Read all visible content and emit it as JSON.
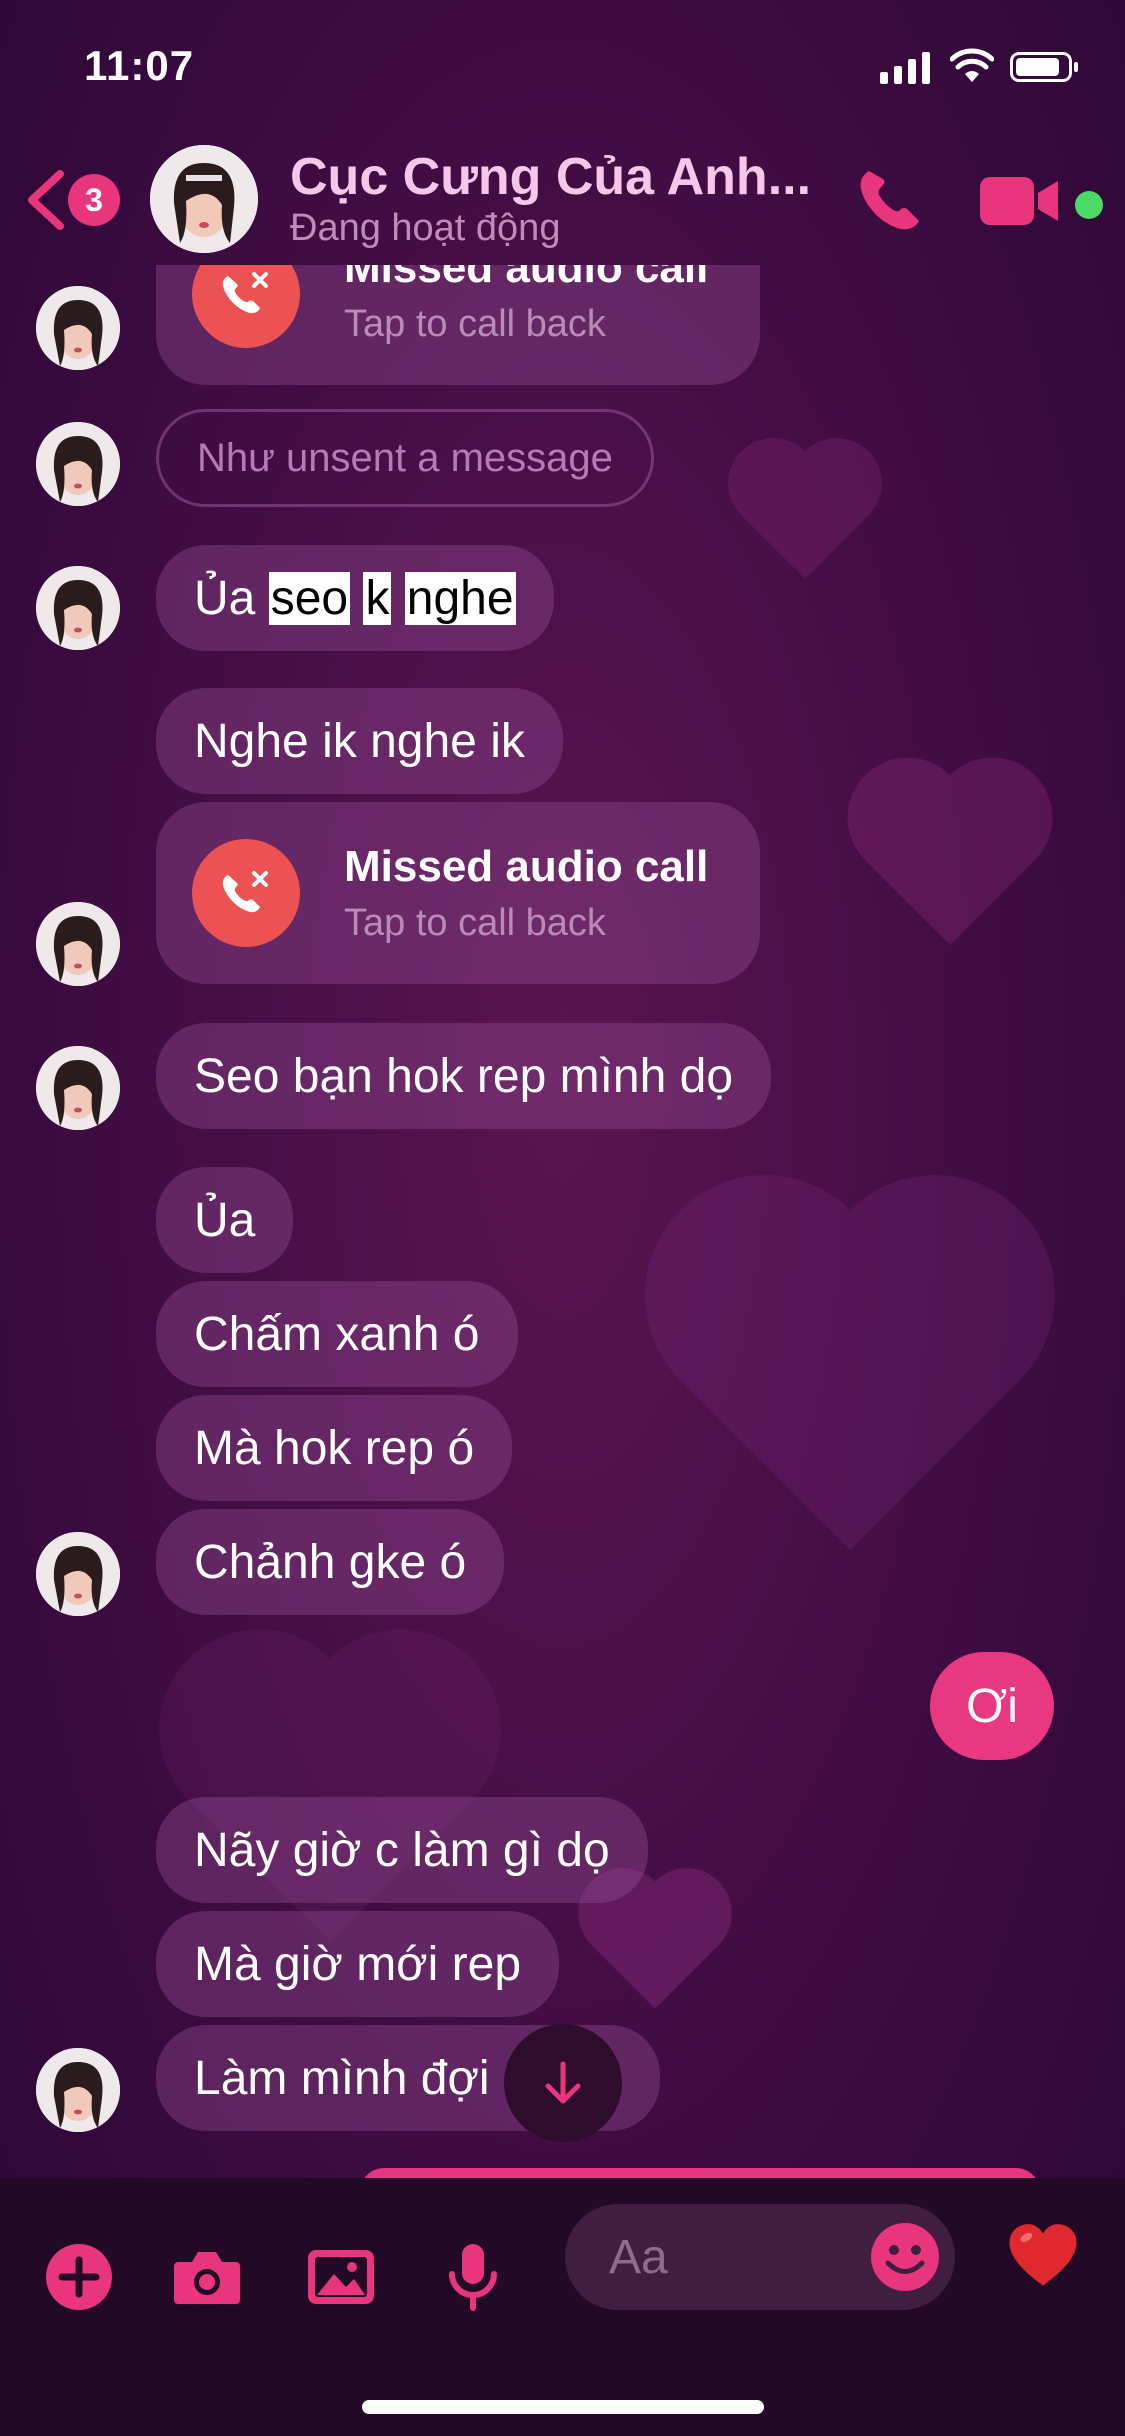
{
  "status_bar": {
    "time": "11:07"
  },
  "header": {
    "back_badge": "3",
    "contact_name": "Cục Cưng Của Anh...",
    "contact_status": "Đang hoạt động"
  },
  "messages": [
    {
      "type": "missed_call",
      "title": "Missed audio call",
      "subtitle": "Tap to call back"
    },
    {
      "type": "unsent",
      "text": "Như unsent a message"
    },
    {
      "type": "text",
      "text": "Ủa seo k nghe"
    },
    {
      "type": "text",
      "text": "Nghe ik nghe ik"
    },
    {
      "type": "missed_call",
      "title": "Missed audio call",
      "subtitle": "Tap to call back"
    },
    {
      "type": "text",
      "text": "Seo bạn hok rep mình dọ"
    },
    {
      "type": "text",
      "text": "Ủa"
    },
    {
      "type": "text",
      "text": "Chấm xanh ó"
    },
    {
      "type": "text",
      "text": "Mà hok rep ó"
    },
    {
      "type": "text",
      "text": "Chảnh gke ó"
    },
    {
      "type": "outgoing",
      "text": "Ơi"
    },
    {
      "type": "text",
      "text": "Nãy giờ c làm gì dọ"
    },
    {
      "type": "text",
      "text": "Mà giờ mới rep"
    },
    {
      "type": "text",
      "text": "Làm mình đợi"
    }
  ],
  "composer": {
    "placeholder": "Aa"
  },
  "icons": {
    "back": "chevron-left-icon",
    "phone": "phone-icon",
    "video": "video-camera-icon",
    "plus": "plus-icon",
    "camera": "camera-icon",
    "gallery": "image-icon",
    "mic": "microphone-icon",
    "emoji": "smiley-icon",
    "like": "heart-icon",
    "scroll": "arrow-down-icon"
  },
  "colors": {
    "accent": "#e8357c",
    "missed_call": "#ec5153",
    "active": "#4cd964"
  }
}
